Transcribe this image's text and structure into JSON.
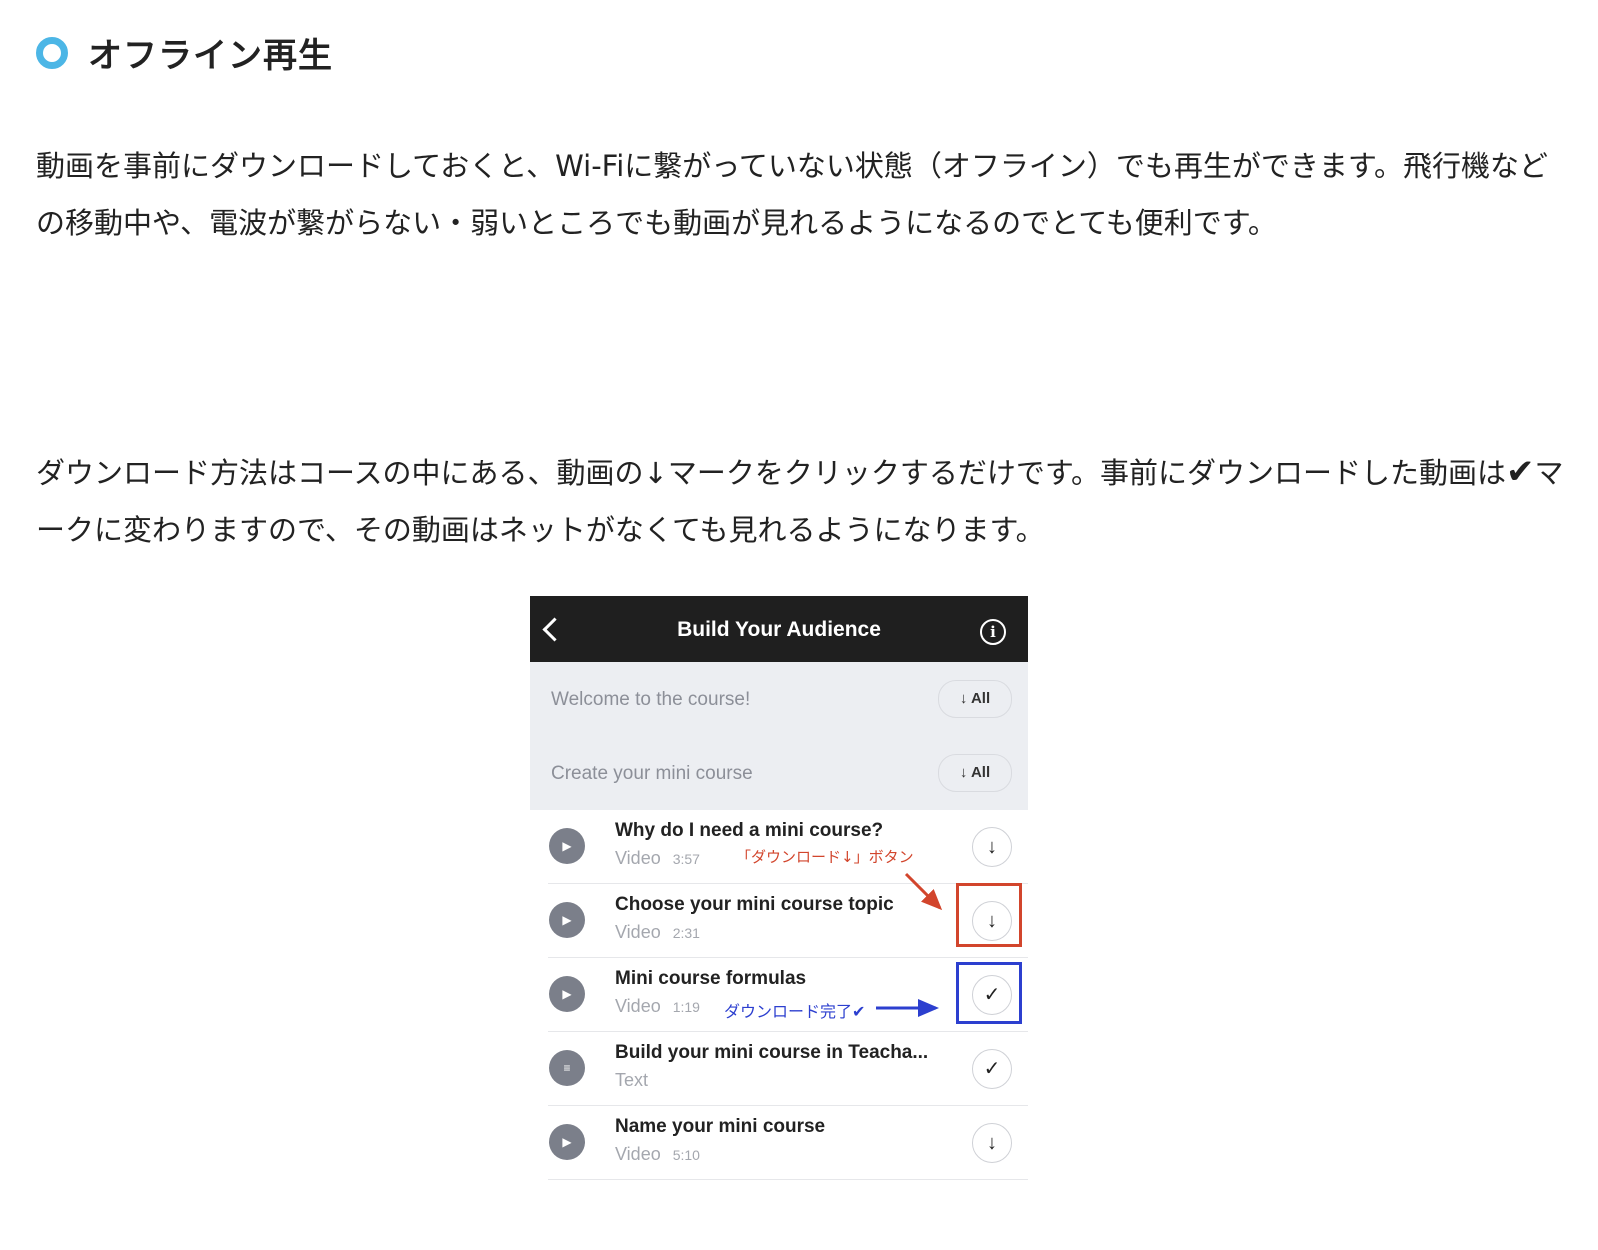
{
  "heading": {
    "title": "オフライン再生"
  },
  "paragraphs": {
    "p1": "動画を事前にダウンロードしておくと、Wi-Fiに繋がっていない状態（オフライン）でも再生ができます。飛行機などの移動中や、電波が繋がらない・弱いところでも動画が見れるようになるのでとても便利です。",
    "p2_before": "ダウンロード方法はコースの中にある、動画の↓マークをクリックするだけです。事前にダウンロードした動画は",
    "p2_check": "✔",
    "p2_after": "マークに変わりますので、その動画はネットがなくても見れるようになります。"
  },
  "phone": {
    "title": "Build Your Audience",
    "info_icon": "i",
    "sections": [
      {
        "name": "Welcome to the course!",
        "button": "↓ All"
      },
      {
        "name": "Create your mini course",
        "button": "↓ All"
      }
    ],
    "lessons": [
      {
        "title": "Why do I need a mini course?",
        "type": "Video",
        "duration": "3:57",
        "icon": "play-icon",
        "state": "↓"
      },
      {
        "title": "Choose your mini course topic",
        "type": "Video",
        "duration": "2:31",
        "icon": "play-icon",
        "state": "↓"
      },
      {
        "title": "Mini course formulas",
        "type": "Video",
        "duration": "1:19",
        "icon": "play-icon",
        "state": "✓"
      },
      {
        "title": "Build your mini course in Teacha...",
        "type": "Text",
        "duration": "",
        "icon": "text-icon",
        "state": "✓"
      },
      {
        "title": "Name your mini course",
        "type": "Video",
        "duration": "5:10",
        "icon": "play-icon",
        "state": "↓"
      }
    ]
  },
  "annotations": {
    "download_button": "「ダウンロード↓」ボタン",
    "download_done": "ダウンロード完了✔",
    "red": "#d2452c",
    "blue": "#2c3fcf"
  }
}
